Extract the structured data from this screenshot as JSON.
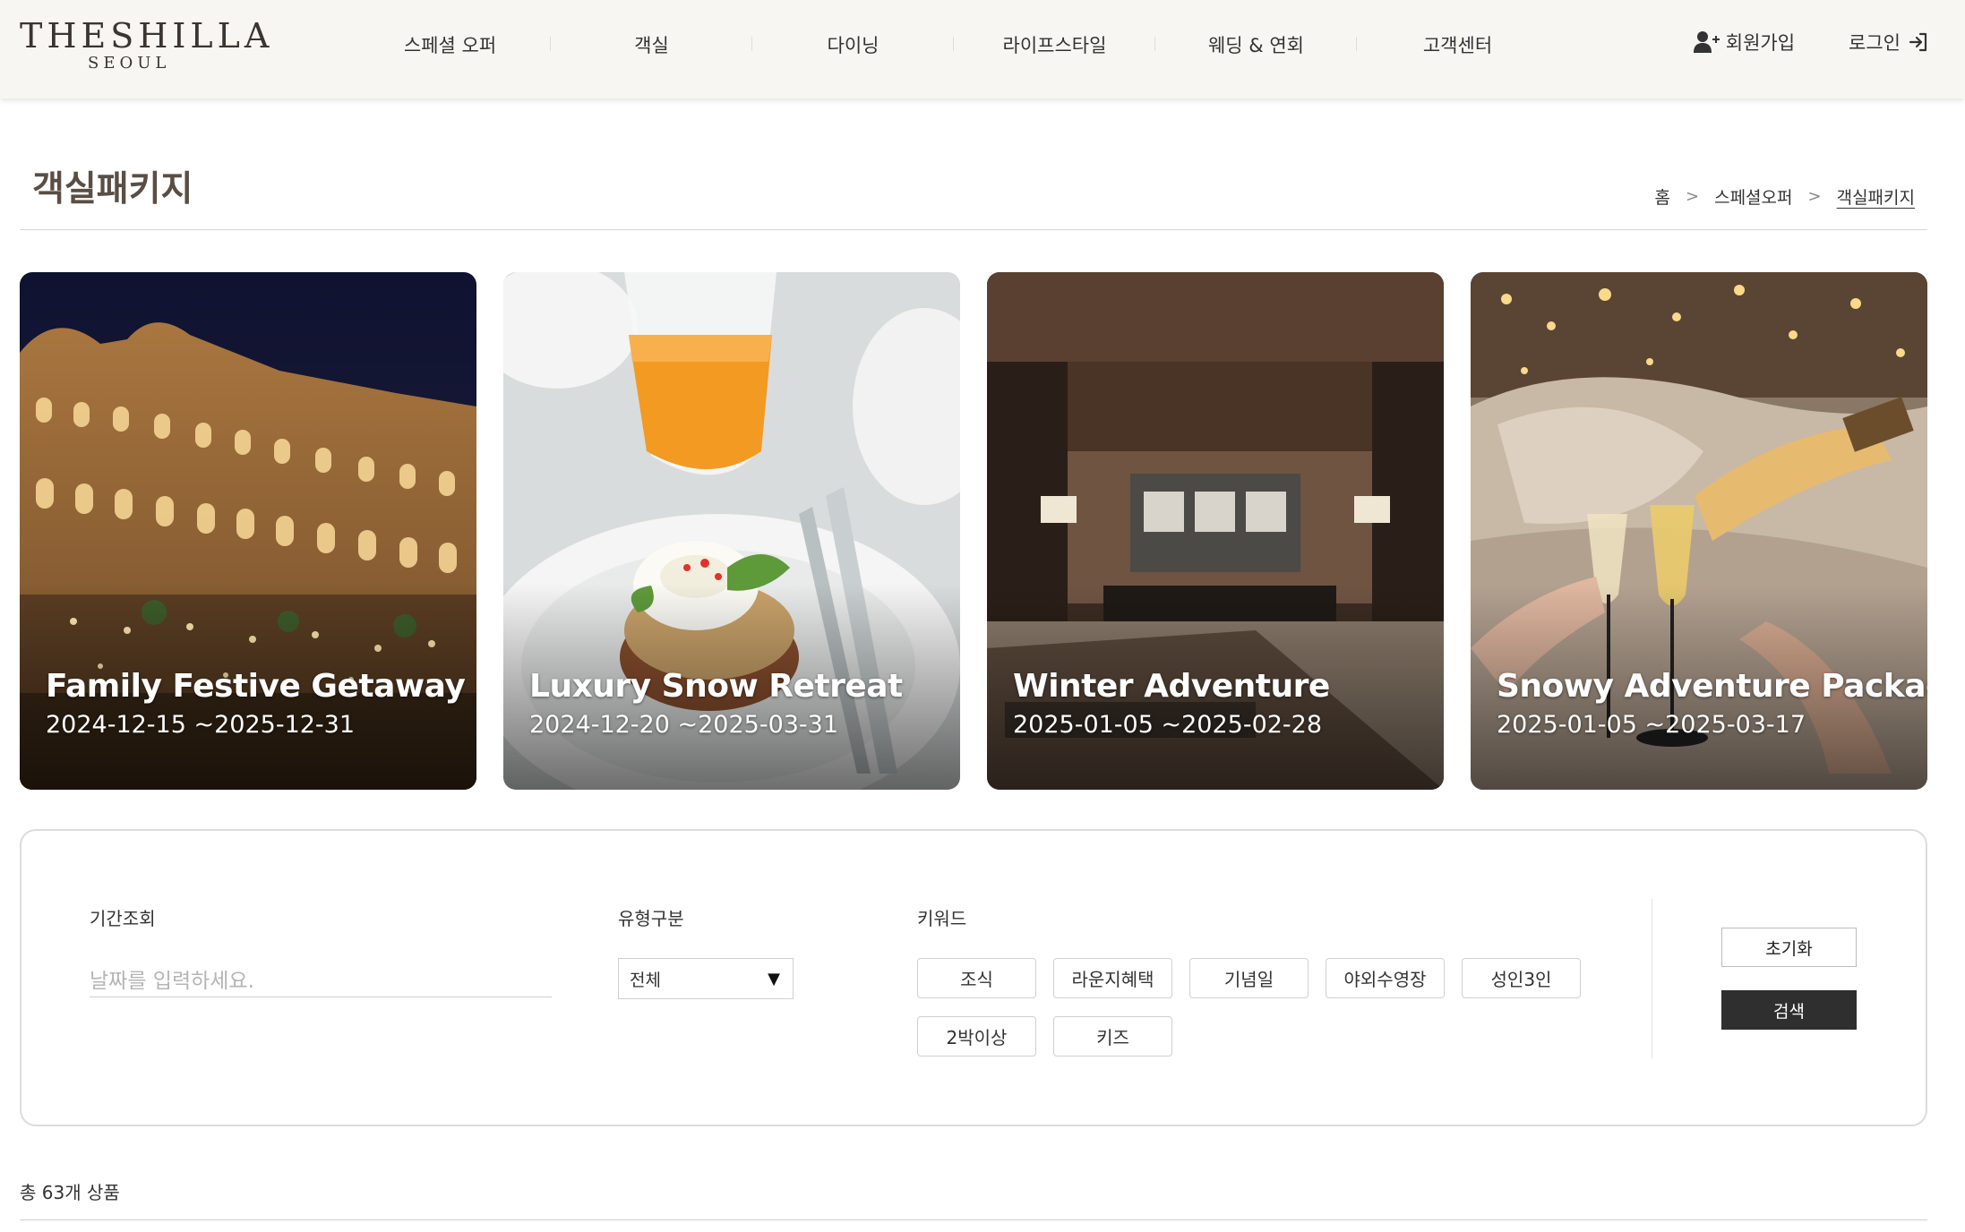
{
  "header": {
    "logo_main": "THESHILLA",
    "logo_sub": "SEOUL",
    "nav": [
      {
        "label": "스페셜 오퍼"
      },
      {
        "label": "객실"
      },
      {
        "label": "다이닝"
      },
      {
        "label": "라이프스타일"
      },
      {
        "label": "웨딩 & 연회"
      },
      {
        "label": "고객센터"
      }
    ],
    "signup_label": "회원가입",
    "login_label": "로그인"
  },
  "page": {
    "title": "객실패키지",
    "breadcrumb": [
      "홈",
      "스페셜오퍼",
      "객실패키지"
    ]
  },
  "cards": [
    {
      "title": "Family Festive Getaway",
      "date": "2024-12-15 ~2025-12-31"
    },
    {
      "title": "Luxury Snow Retreat",
      "date": "2024-12-20 ~2025-03-31"
    },
    {
      "title": "Winter Adventure",
      "date": "2025-01-05 ~2025-02-28"
    },
    {
      "title": "Snowy Adventure Package",
      "date": "2025-01-05 ~2025-03-17"
    }
  ],
  "filter": {
    "period_label": "기간조회",
    "date_placeholder": "날짜를 입력하세요.",
    "type_label": "유형구분",
    "type_selected": "전체",
    "keyword_label": "키워드",
    "keywords": [
      "조식",
      "라운지혜택",
      "기념일",
      "야외수영장",
      "성인3인",
      "2박이상",
      "키즈"
    ],
    "reset_label": "초기화",
    "search_label": "검색"
  },
  "result": {
    "total_text": "총 63개 상품"
  }
}
